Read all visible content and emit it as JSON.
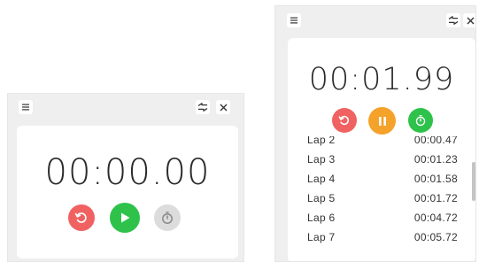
{
  "left_window": {
    "time": "00:00.00",
    "reset_icon": "reset-icon",
    "play_icon": "play-icon",
    "lap_icon": "stopwatch-icon",
    "lap_enabled": false
  },
  "right_window": {
    "time": "00:01.99",
    "reset_icon": "reset-icon",
    "pause_icon": "pause-icon",
    "lap_icon": "stopwatch-icon",
    "lap_enabled": true,
    "laps": [
      {
        "label": "Lap 2",
        "time": "00:00.47"
      },
      {
        "label": "Lap 3",
        "time": "00:01.23"
      },
      {
        "label": "Lap 4",
        "time": "00:01.58"
      },
      {
        "label": "Lap 5",
        "time": "00:01.72"
      },
      {
        "label": "Lap 6",
        "time": "00:04.72"
      },
      {
        "label": "Lap 7",
        "time": "00:05.72"
      }
    ]
  },
  "titlebar_icons": {
    "menu": "menu-icon",
    "compact": "compact-overlay-icon",
    "close": "close-icon"
  },
  "colors": {
    "reset": "#f06262",
    "play": "#2ec24a",
    "pause": "#f5a22a",
    "lap": "#2ec24a",
    "lap_disabled": "#dcdcdc",
    "window_bg": "#efefef",
    "card_bg": "#ffffff"
  }
}
